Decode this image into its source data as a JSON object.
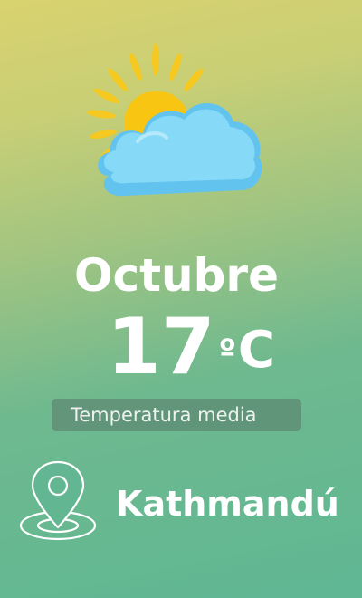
{
  "weather": {
    "icon": "sun-behind-cloud-icon",
    "month": "Octubre",
    "temperature": "17",
    "degree_symbol": "º",
    "unit": "C",
    "label": "Temperatura media"
  },
  "location": {
    "icon": "map-pin-icon",
    "city": "Kathmandú"
  },
  "colors": {
    "background_top": "#d9d26f",
    "background_bottom": "#5fb793",
    "sun": "#f9c511",
    "cloud": "#7fd4f4",
    "text": "#ffffff"
  }
}
